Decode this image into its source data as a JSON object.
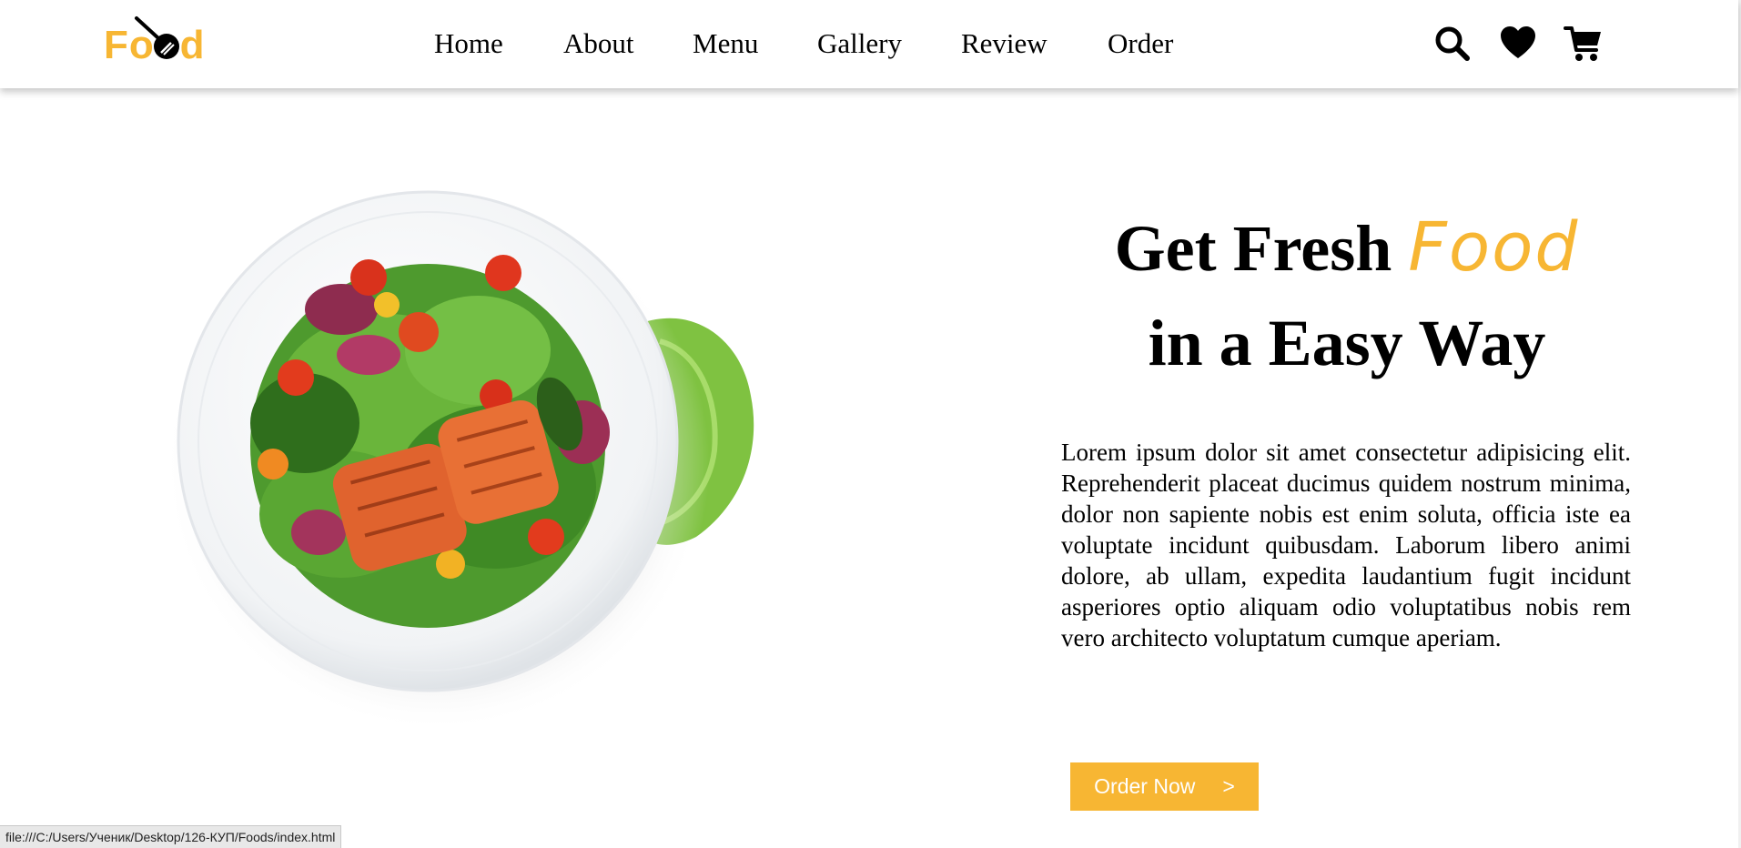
{
  "header": {
    "logo_text": "Food",
    "nav": [
      "Home",
      "About",
      "Menu",
      "Gallery",
      "Review",
      "Order"
    ],
    "icons": [
      "search-icon",
      "heart-icon",
      "cart-icon"
    ]
  },
  "hero": {
    "title_line1": "Get Fresh",
    "title_accent": "Food",
    "title_line2": "in a Easy Way",
    "description": "Lorem ipsum dolor sit amet consectetur adipisicing elit. Reprehenderit placeat ducimus quidem nostrum minima, dolor non sapiente nobis est enim soluta, officia iste ea voluptate incidunt quibusdam. Laborum libero animi dolore, ab ullam, expedita laudantium fugit incidunt asperiores optio aliquam odio voluptatibus nobis rem vero architecto voluptatum cumque aperiam.",
    "button_label": "Order Now",
    "button_arrow": ">"
  },
  "statusbar": {
    "url": "file:///C:/Users/Ученик/Desktop/126-КУП/Foods/index.html"
  },
  "colors": {
    "accent": "#f7b633"
  }
}
